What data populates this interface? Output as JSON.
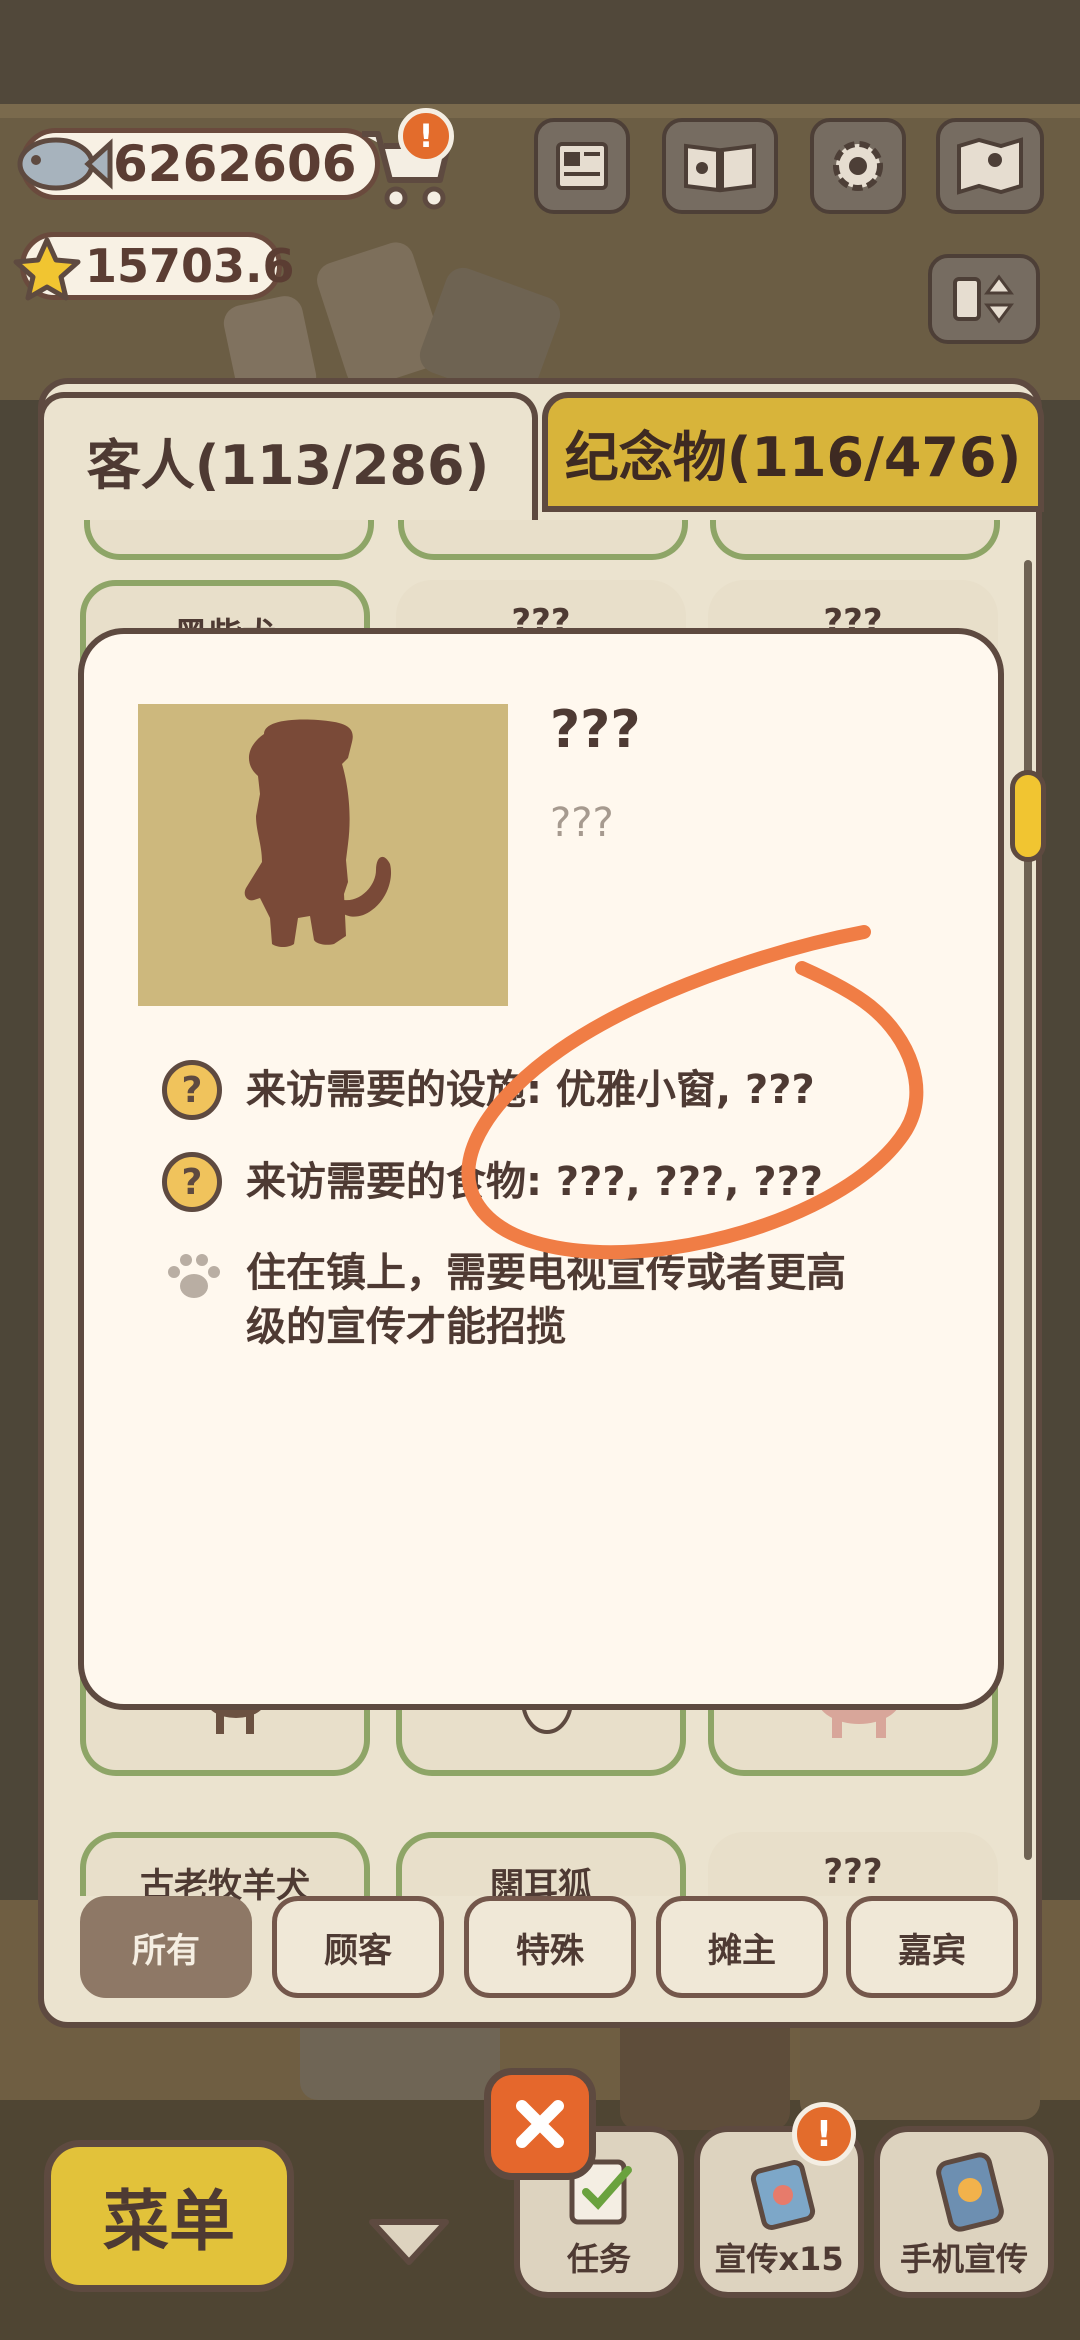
{
  "currency": {
    "fish_icon": "fish-icon",
    "fish_amount": "6262606",
    "star_icon": "star-icon",
    "star_amount": "15703.6",
    "shop_icon": "cart-icon"
  },
  "tabs": {
    "guests": "客人(113/286)",
    "souvenirs": "纪念物(116/476)"
  },
  "cards": {
    "row1": [
      "黑柴犬",
      "???",
      "???"
    ],
    "row3": [
      "古老牧羊犬",
      "闊耳狐",
      "???"
    ]
  },
  "filters": [
    "所有",
    "顾客",
    "特殊",
    "摊主",
    "嘉宾"
  ],
  "modal": {
    "title": "???",
    "subtitle": "???",
    "facility_req": "来访需要的设施: 优雅小窗, ???",
    "food_req": "来访需要的食物: ???, ???, ???",
    "note_line1": "住在镇上，需要电视宣传或者更高",
    "note_line2": "级的宣传才能招揽"
  },
  "bottom": {
    "menu": "菜单",
    "tasks": "任务",
    "promo": "宣传x15",
    "phone_promo": "手机宣传",
    "alert": "!"
  },
  "colors": {
    "accent_yellow": "#f1c531",
    "annotation_orange": "#f07d45",
    "card_border_green": "#8ea567",
    "alert_orange": "#e36c2c"
  }
}
